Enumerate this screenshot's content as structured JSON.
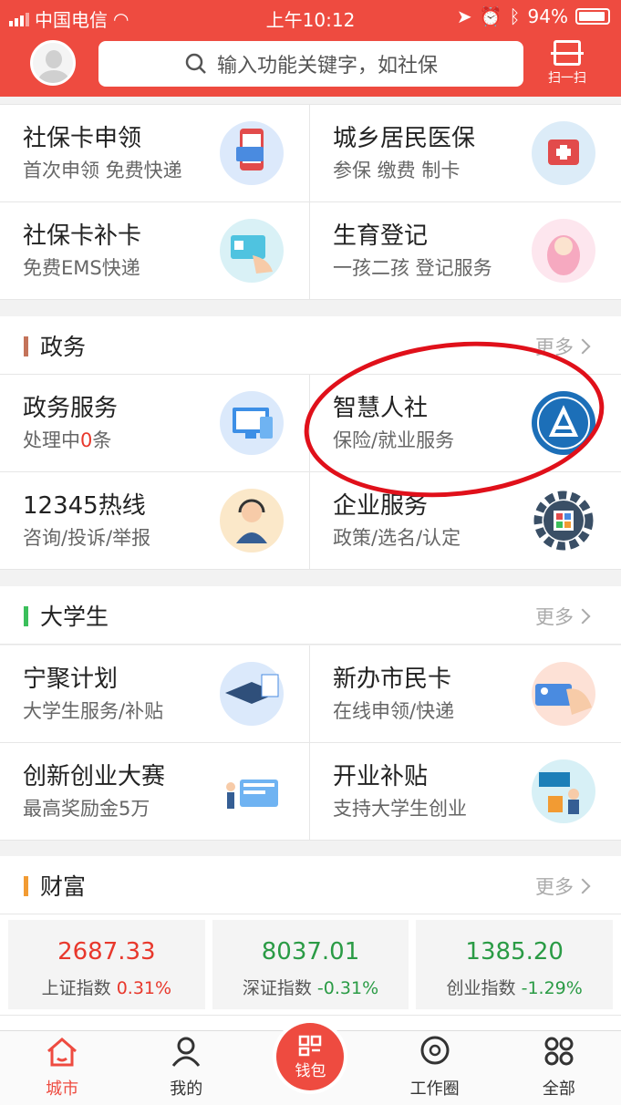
{
  "status": {
    "carrier": "中国电信",
    "time": "上午10:12",
    "battery": "94%"
  },
  "header": {
    "search_placeholder": "输入功能关键字，如社保",
    "scan_label": "扫一扫"
  },
  "top_grid": [
    [
      {
        "title": "社保卡申领",
        "sub": "首次申领 免费快递"
      },
      {
        "title": "城乡居民医保",
        "sub": "参保 缴费 制卡"
      }
    ],
    [
      {
        "title": "社保卡补卡",
        "sub": "免费EMS快递"
      },
      {
        "title": "生育登记",
        "sub": "一孩二孩 登记服务"
      }
    ]
  ],
  "gov": {
    "title": "政务",
    "more": "更多",
    "items": [
      [
        {
          "title": "政务服务",
          "sub_prefix": "处理中",
          "sub_count": "0",
          "sub_suffix": "条"
        },
        {
          "title": "智慧人社",
          "sub": "保险/就业服务"
        }
      ],
      [
        {
          "title": "12345热线",
          "sub": "咨询/投诉/举报"
        },
        {
          "title": "企业服务",
          "sub": "政策/选名/认定"
        }
      ]
    ]
  },
  "college": {
    "title": "大学生",
    "more": "更多",
    "items": [
      [
        {
          "title": "宁聚计划",
          "sub": "大学生服务/补贴"
        },
        {
          "title": "新办市民卡",
          "sub": "在线申领/快递"
        }
      ],
      [
        {
          "title": "创新创业大赛",
          "sub": "最高奖励金5万"
        },
        {
          "title": "开业补贴",
          "sub": "支持大学生创业"
        }
      ]
    ]
  },
  "wealth": {
    "title": "财富",
    "more": "更多",
    "stocks": [
      {
        "value": "2687.33",
        "name": "上证指数",
        "change": "0.31%"
      },
      {
        "value": "8037.01",
        "name": "深证指数",
        "change": "-0.31%"
      },
      {
        "value": "1385.20",
        "name": "创业指数",
        "change": "-1.29%"
      }
    ]
  },
  "tabs": [
    {
      "label": "城市"
    },
    {
      "label": "我的"
    },
    {
      "label": "钱包"
    },
    {
      "label": "工作圈"
    },
    {
      "label": "全部"
    }
  ],
  "colors": {
    "brand": "#ee4b40",
    "gov_bar": "#c4735a",
    "college_bar": "#3bbf5b",
    "wealth_bar": "#f29b33",
    "up": "#e8382c",
    "down": "#2a9b45"
  }
}
